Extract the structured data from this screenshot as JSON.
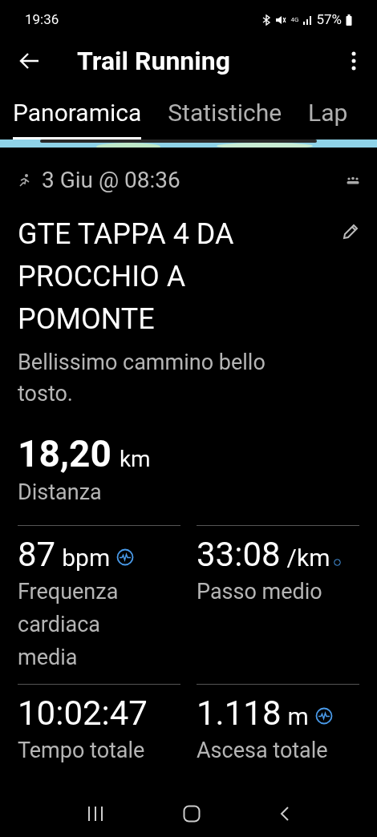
{
  "status_bar": {
    "time": "19:36",
    "network": "4G",
    "battery": "57%"
  },
  "app_bar": {
    "title": "Trail Running"
  },
  "tabs": [
    {
      "label": "Panoramica",
      "selected": true
    },
    {
      "label": "Statistiche",
      "selected": false
    },
    {
      "label": "Lap",
      "selected": false
    }
  ],
  "activity": {
    "date": "3 Giu @ 08:36",
    "title": "GTE TAPPA 4 DA PROCCHIO A POMONTE",
    "description": "Bellissimo cammino bello tosto."
  },
  "distance": {
    "value": "18,20",
    "unit": "km",
    "label": "Distanza"
  },
  "stats": [
    {
      "kind": "pulse",
      "value": "87",
      "unit": "bpm",
      "label": "Frequenza cardiaca media"
    },
    {
      "kind": "dot",
      "value": "33:08",
      "unit": "/km",
      "label": "Passo medio"
    },
    {
      "kind": "plain",
      "value": "10:02:47",
      "label": "Tempo totale"
    },
    {
      "kind": "pulse",
      "value": "1.118",
      "unit": "m",
      "label": "Ascesa totale"
    }
  ]
}
